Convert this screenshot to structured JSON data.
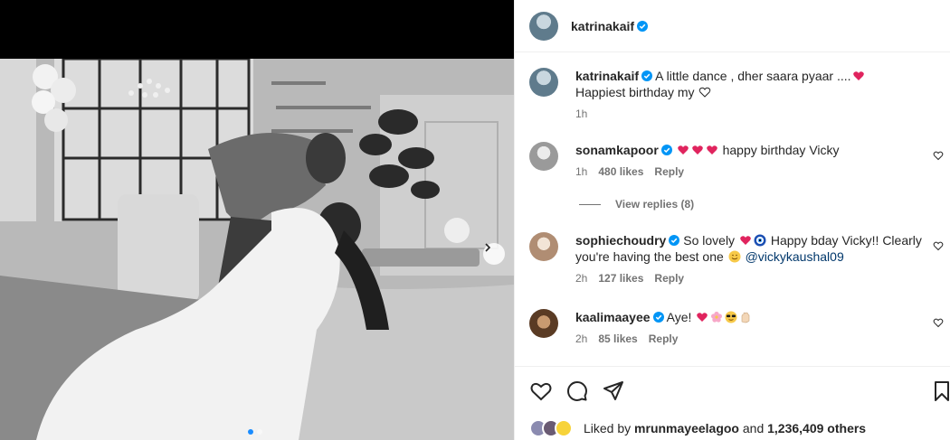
{
  "post": {
    "author": "katrinakaif"
  },
  "caption": {
    "username": "katrinakaif",
    "text_line1": "A little dance , dher saara pyaar ....",
    "text_line2": "Happiest birthday my",
    "time": "1h"
  },
  "comments": [
    {
      "username": "sonamkapoor",
      "text": "happy birthday Vicky",
      "time": "1h",
      "likes": "480 likes",
      "reply": "Reply"
    },
    {
      "username": "sophiechoudry",
      "text_a": "So lovely",
      "text_b": "Happy bday Vicky!! Clearly",
      "text_c": "you're having the best one",
      "mention": "@vickykaushal09",
      "time": "2h",
      "likes": "127 likes",
      "reply": "Reply"
    },
    {
      "username": "kaalimaayee",
      "text": "Aye!",
      "time": "2h",
      "likes": "85 likes",
      "reply": "Reply"
    }
  ],
  "view_replies": "View replies (8)",
  "likes_summary": {
    "prefix": "Liked by",
    "user": "mrunmayeelagoo",
    "middle": "and",
    "count": "1,236,409 others"
  },
  "carousel": {
    "current": 1,
    "total": 2
  },
  "colors": {
    "verified": "#0095f6",
    "heart": "#ed4956",
    "link": "#00376b",
    "muted": "#737373"
  },
  "icons": [
    "verified-icon",
    "heart-icon",
    "comment-icon",
    "share-icon",
    "bookmark-icon",
    "chevron-right-icon"
  ]
}
